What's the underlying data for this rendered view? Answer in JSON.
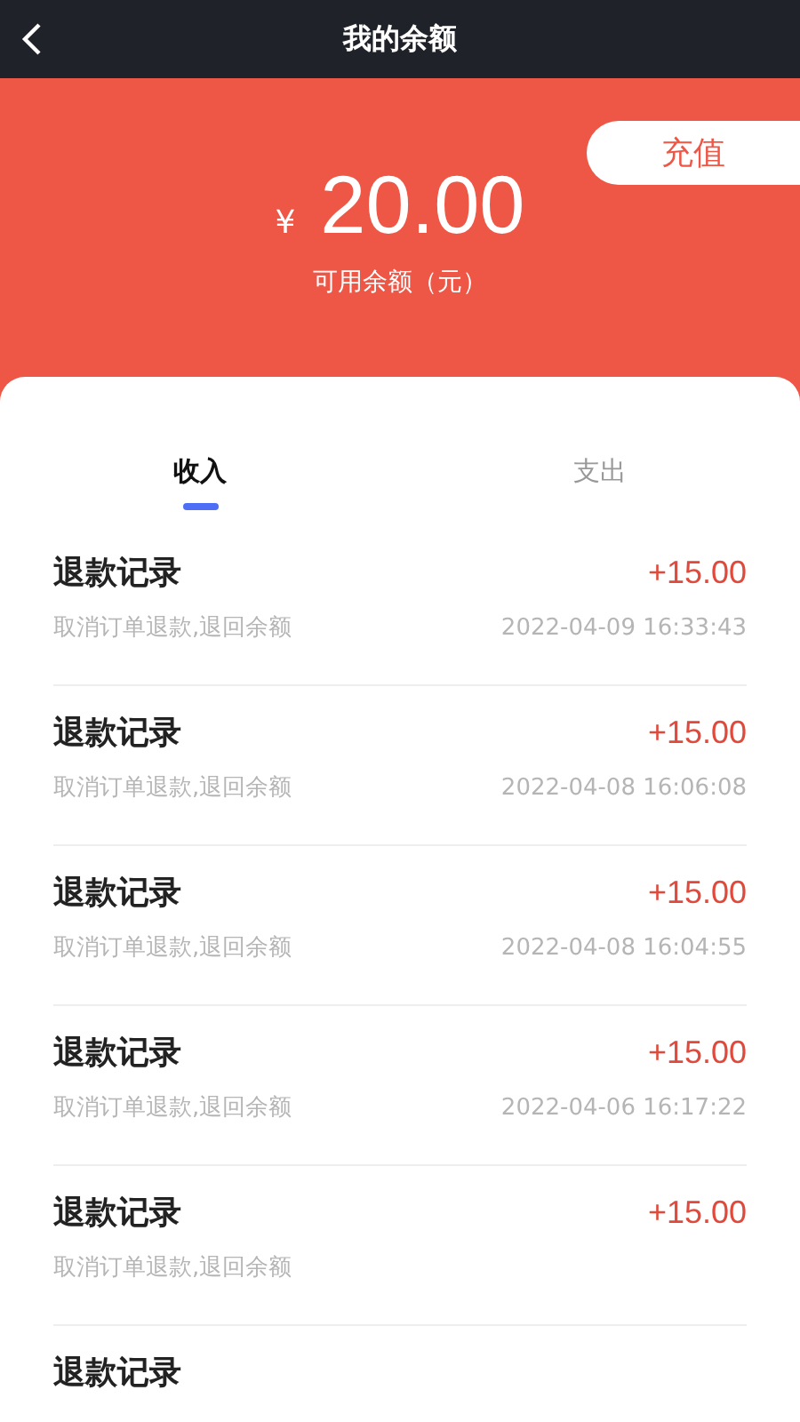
{
  "header": {
    "title": "我的余额"
  },
  "balance": {
    "currency": "¥",
    "amount": "20.00",
    "label": "可用余额（元）",
    "recharge": "充值"
  },
  "tabs": [
    {
      "label": "收入",
      "selected": true
    },
    {
      "label": "支出",
      "selected": false
    }
  ],
  "records": [
    {
      "title": "退款记录",
      "desc": "取消订单退款,退回余额",
      "amount": "+15.00",
      "time": "2022-04-09 16:33:43"
    },
    {
      "title": "退款记录",
      "desc": "取消订单退款,退回余额",
      "amount": "+15.00",
      "time": "2022-04-08 16:06:08"
    },
    {
      "title": "退款记录",
      "desc": "取消订单退款,退回余额",
      "amount": "+15.00",
      "time": "2022-04-08 16:04:55"
    },
    {
      "title": "退款记录",
      "desc": "取消订单退款,退回余额",
      "amount": "+15.00",
      "time": "2022-04-06 16:17:22"
    },
    {
      "title": "退款记录",
      "desc": "取消订单退款,退回余额",
      "amount": "+15.00"
    },
    {
      "title": "退款记录"
    }
  ]
}
